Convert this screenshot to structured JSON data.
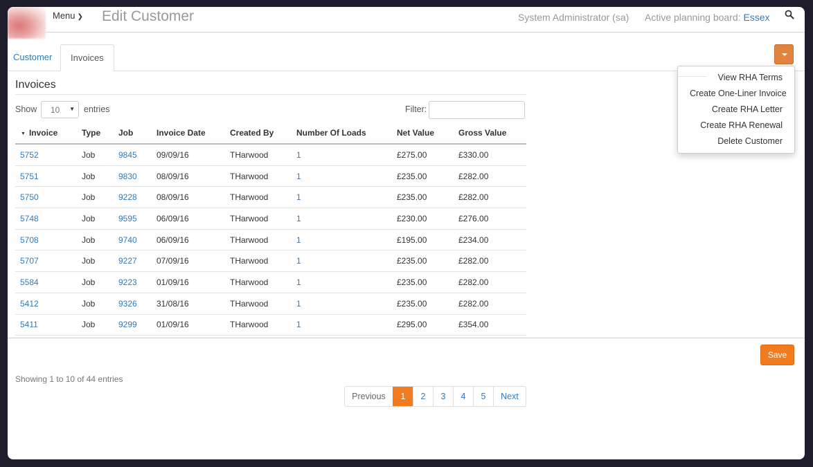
{
  "header": {
    "menu_label": "Menu",
    "title": "Edit Customer",
    "user": "System Administrator (sa)",
    "board_label": "Active planning board:",
    "board_value": "Essex"
  },
  "tabs": [
    {
      "label": "Customer",
      "active": false
    },
    {
      "label": "Invoices",
      "active": true
    }
  ],
  "actions_menu": [
    {
      "label": "View RHA Terms"
    },
    {
      "label": "Create One-Liner Invoice"
    },
    {
      "label": "Create RHA Letter"
    },
    {
      "label": "Create RHA Renewal"
    },
    {
      "label": "Delete Customer"
    }
  ],
  "section": {
    "title": "Invoices",
    "show_label": "Show",
    "page_length": "10",
    "entries_label": "entries",
    "filter_label": "Filter:",
    "filter_value": ""
  },
  "table": {
    "columns": [
      "Invoice",
      "Type",
      "Job",
      "Invoice Date",
      "Created By",
      "Number Of Loads",
      "Net Value",
      "Gross Value"
    ],
    "rows": [
      {
        "invoice": "5752",
        "type": "Job",
        "job": "9845",
        "date": "09/09/16",
        "created_by": "THarwood",
        "loads": "1",
        "net": "£275.00",
        "gross": "£330.00"
      },
      {
        "invoice": "5751",
        "type": "Job",
        "job": "9830",
        "date": "08/09/16",
        "created_by": "THarwood",
        "loads": "1",
        "net": "£235.00",
        "gross": "£282.00"
      },
      {
        "invoice": "5750",
        "type": "Job",
        "job": "9228",
        "date": "08/09/16",
        "created_by": "THarwood",
        "loads": "1",
        "net": "£235.00",
        "gross": "£282.00"
      },
      {
        "invoice": "5748",
        "type": "Job",
        "job": "9595",
        "date": "06/09/16",
        "created_by": "THarwood",
        "loads": "1",
        "net": "£230.00",
        "gross": "£276.00"
      },
      {
        "invoice": "5708",
        "type": "Job",
        "job": "9740",
        "date": "06/09/16",
        "created_by": "THarwood",
        "loads": "1",
        "net": "£195.00",
        "gross": "£234.00"
      },
      {
        "invoice": "5707",
        "type": "Job",
        "job": "9227",
        "date": "07/09/16",
        "created_by": "THarwood",
        "loads": "1",
        "net": "£235.00",
        "gross": "£282.00"
      },
      {
        "invoice": "5584",
        "type": "Job",
        "job": "9223",
        "date": "01/09/16",
        "created_by": "THarwood",
        "loads": "1",
        "net": "£235.00",
        "gross": "£282.00"
      },
      {
        "invoice": "5412",
        "type": "Job",
        "job": "9326",
        "date": "31/08/16",
        "created_by": "THarwood",
        "loads": "1",
        "net": "£235.00",
        "gross": "£282.00"
      },
      {
        "invoice": "5411",
        "type": "Job",
        "job": "9299",
        "date": "01/09/16",
        "created_by": "THarwood",
        "loads": "1",
        "net": "£295.00",
        "gross": "£354.00"
      }
    ]
  },
  "footer": {
    "save_label": "Save",
    "info": "Showing 1 to 10 of 44 entries",
    "pagination": {
      "previous": "Previous",
      "pages": [
        "1",
        "2",
        "3",
        "4",
        "5"
      ],
      "current": "1",
      "next": "Next"
    }
  },
  "colors": {
    "accent": "#f07c1f",
    "link": "#337ab7",
    "frame_bg": "#1f1c2b"
  },
  "icons": {
    "search": "search-icon",
    "menu_chevron": "chevron-down-icon",
    "dropdown_caret": "caret-down-icon",
    "sort": "sort-desc-icon"
  }
}
